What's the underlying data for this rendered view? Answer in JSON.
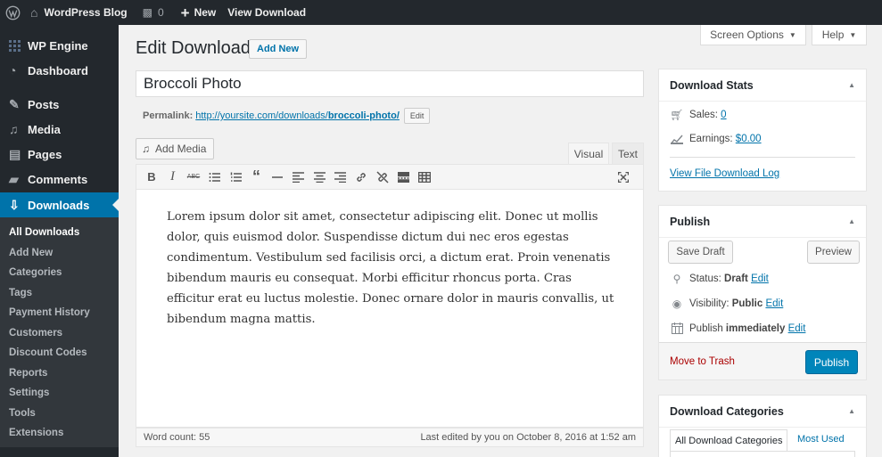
{
  "admin_bar": {
    "site_name": "WordPress Blog",
    "comment_count": "0",
    "new_label": "New",
    "view_label": "View Download"
  },
  "sidebar": {
    "items": [
      {
        "label": "WP Engine",
        "icon": "grid-icon"
      },
      {
        "label": "Dashboard",
        "icon": "dashboard-icon"
      },
      {
        "label": "Posts",
        "icon": "pin-icon"
      },
      {
        "label": "Media",
        "icon": "media-icon"
      },
      {
        "label": "Pages",
        "icon": "pages-icon"
      },
      {
        "label": "Comments",
        "icon": "comment-icon"
      },
      {
        "label": "Downloads",
        "icon": "download-icon"
      }
    ],
    "submenu": [
      "All Downloads",
      "Add New",
      "Categories",
      "Tags",
      "Payment History",
      "Customers",
      "Discount Codes",
      "Reports",
      "Settings",
      "Tools",
      "Extensions"
    ]
  },
  "screen_options": "Screen Options",
  "help": "Help",
  "page": {
    "title": "Edit Download",
    "add_new": "Add New",
    "post_title": "Broccoli Photo",
    "permalink_label": "Permalink:",
    "permalink_base": "http://yoursite.com/downloads/",
    "permalink_slug": "broccoli-photo/",
    "edit_label": "Edit",
    "add_media": "Add Media",
    "tab_visual": "Visual",
    "tab_text": "Text",
    "content": "Lorem ipsum dolor sit amet, consectetur adipiscing elit. Donec ut mollis dolor, quis euismod dolor. Suspendisse dictum dui nec eros egestas condimentum. Vestibulum sed facilisis orci, a dictum erat. Proin venenatis bibendum mauris eu consequat. Morbi efficitur rhoncus porta. Cras efficitur erat eu luctus molestie. Donec ornare dolor in mauris convallis, ut bibendum magna mattis.",
    "word_count": "Word count: 55",
    "last_edited": "Last edited by you on October 8, 2016 at 1:52 am"
  },
  "download_stats": {
    "title": "Download Stats",
    "sales_label": "Sales:",
    "sales_value": "0",
    "earnings_label": "Earnings:",
    "earnings_value": "$0.00",
    "log_link": "View File Download Log"
  },
  "publish": {
    "title": "Publish",
    "save_draft": "Save Draft",
    "preview": "Preview",
    "status_label": "Status:",
    "status_value": "Draft",
    "visibility_label": "Visibility:",
    "visibility_value": "Public",
    "publish_label": "Publish",
    "publish_value": "immediately",
    "edit": "Edit",
    "trash": "Move to Trash",
    "publish_button": "Publish"
  },
  "categories": {
    "title": "Download Categories",
    "tab_all": "All Download Categories",
    "tab_used": "Most Used"
  },
  "colors": {
    "admin_dark": "#23282d",
    "accent": "#0073aa",
    "primary_button": "#0085ba",
    "trash": "#a00"
  }
}
